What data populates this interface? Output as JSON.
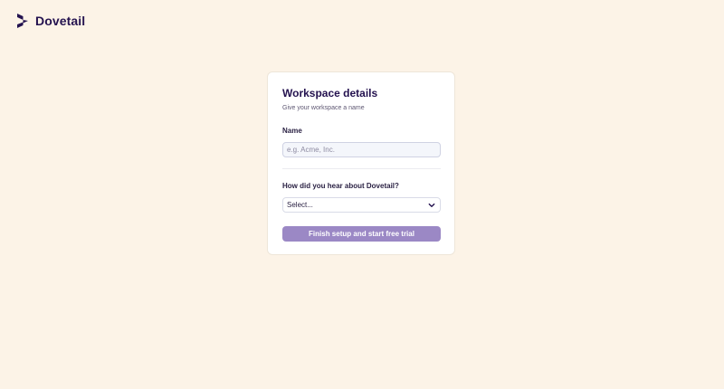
{
  "brand": {
    "name": "Dovetail",
    "logo_icon": "dovetail-logo-icon",
    "color": "#24124f"
  },
  "card": {
    "title": "Workspace details",
    "subtitle": "Give your workspace a name",
    "name_field": {
      "label": "Name",
      "placeholder": "e.g. Acme, Inc.",
      "value": ""
    },
    "source_field": {
      "label": "How did you hear about Dovetail?",
      "selected": "Select...",
      "icon": "chevron-down-icon"
    },
    "submit_button": {
      "label": "Finish setup and start free trial",
      "color": "#9b88c5"
    }
  },
  "colors": {
    "background": "#fcf3e7",
    "card": "#ffffff",
    "text": "#24124f"
  }
}
